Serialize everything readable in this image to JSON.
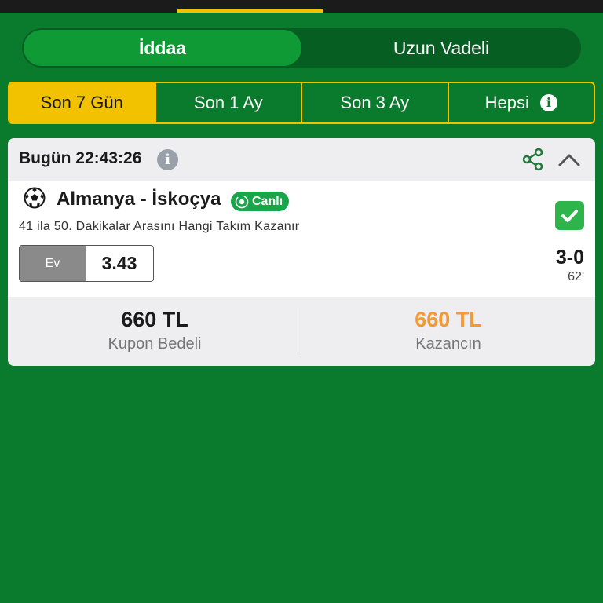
{
  "header": {
    "segments": [
      {
        "label": "İddaa",
        "active": true
      },
      {
        "label": "Uzun Vadeli",
        "active": false
      }
    ]
  },
  "filters": [
    {
      "label": "Son 7 Gün",
      "active": true
    },
    {
      "label": "Son 1 Ay",
      "active": false
    },
    {
      "label": "Son 3 Ay",
      "active": false
    },
    {
      "label": "Hepsi",
      "active": false,
      "icon": "info-icon"
    }
  ],
  "coupon": {
    "date": "Bugün 22:43:26",
    "icons": [
      "info-icon",
      "share-icon",
      "chevron-up-icon"
    ],
    "match": {
      "sport_icon": "soccer-ball-icon",
      "teams": "Almanya - İskoçya",
      "live_label": "Canlı",
      "market": "41 ila 50. Dakikalar Arasını Hangi Takım Kazanır",
      "selection_label": "Ev",
      "odds": "3.43",
      "score": "3-0",
      "minute": "62'",
      "status": "won"
    },
    "stake_amount": "660 TL",
    "stake_label": "Kupon Bedeli",
    "win_amount": "660 TL",
    "win_label": "Kazancın"
  },
  "colors": {
    "background": "#0a7a2c",
    "accent_yellow": "#f2c200",
    "win_orange": "#f39a34",
    "live_green": "#19a64a",
    "check_green": "#2db54b"
  }
}
